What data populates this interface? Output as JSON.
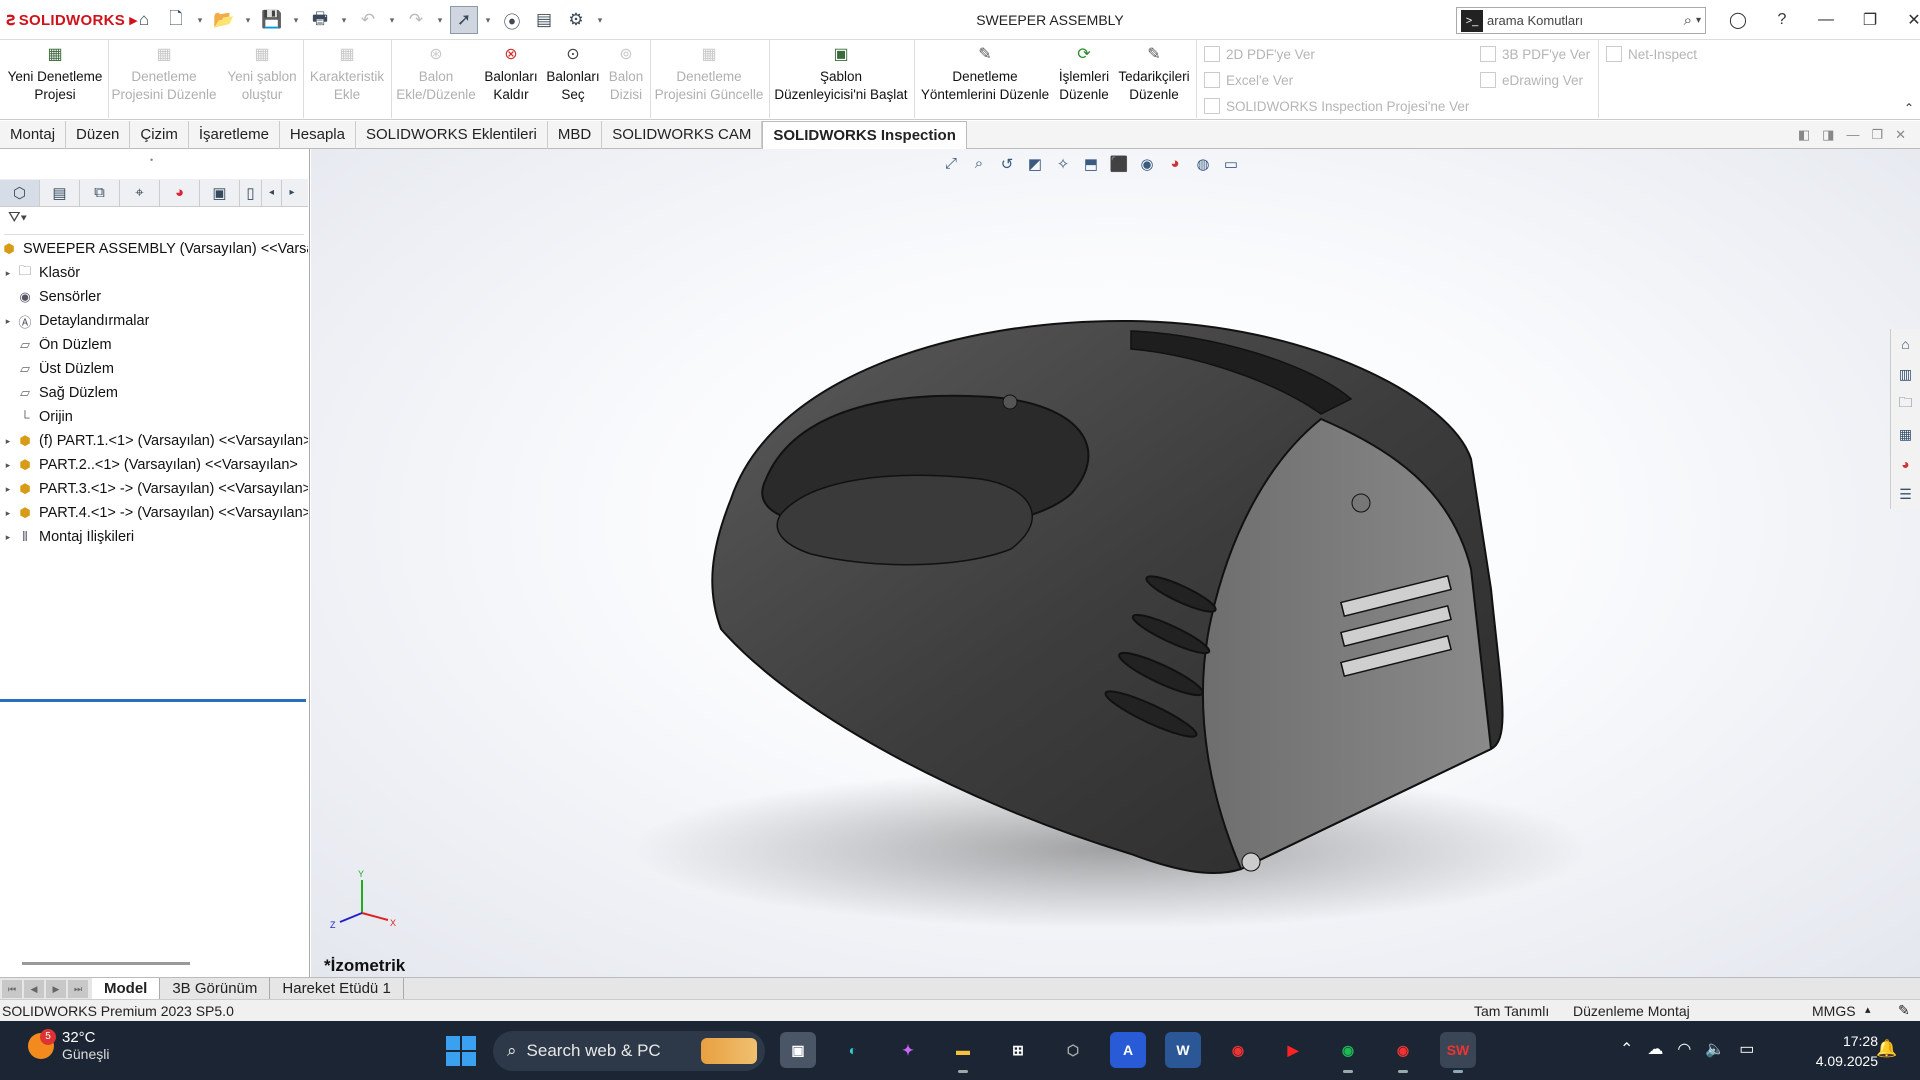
{
  "app": {
    "brand": "SOLIDWORKS",
    "window_title": "SWEEPER ASSEMBLY",
    "search_placeholder": "arama Komutları"
  },
  "ribbon": {
    "buttons": [
      {
        "label": "Yeni Denetleme\nProjesi",
        "enabled": true
      },
      {
        "label": "Denetleme\nProjesini Düzenle",
        "enabled": false
      },
      {
        "label": "Yeni şablon\noluştur",
        "enabled": false
      },
      {
        "label": "Karakteristik\nEkle",
        "enabled": false
      },
      {
        "label": "Balon\nEkle/Düzenle",
        "enabled": false
      },
      {
        "label": "Balonları\nKaldır",
        "enabled": true
      },
      {
        "label": "Balonları\nSeç",
        "enabled": true
      },
      {
        "label": "Balon\nDizisi",
        "enabled": false
      },
      {
        "label": "Denetleme\nProjesini Güncelle",
        "enabled": false
      },
      {
        "label": "Şablon\nDüzenleyicisi'ni Başlat",
        "enabled": true
      },
      {
        "label": "Denetleme\nYöntemlerini Düzenle",
        "enabled": true
      },
      {
        "label": "İşlemleri\nDüzenle",
        "enabled": true
      },
      {
        "label": "Tedarikçileri\nDüzenle",
        "enabled": true
      }
    ],
    "export_items": [
      "2D PDF'ye Ver",
      "Excel'e Ver",
      "SOLIDWORKS Inspection Projesi'ne Ver",
      "3B PDF'ye Ver",
      "eDrawing Ver",
      "Net-Inspect"
    ]
  },
  "tabs": [
    "Montaj",
    "Düzen",
    "Çizim",
    "İşaretleme",
    "Hesapla",
    "SOLIDWORKS Eklentileri",
    "MBD",
    "SOLIDWORKS CAM",
    "SOLIDWORKS Inspection"
  ],
  "active_tab": "SOLIDWORKS Inspection",
  "tree": {
    "root": "SWEEPER ASSEMBLY (Varsayılan) <<Varsayılan>",
    "items": [
      {
        "label": "Klasör",
        "expandable": true,
        "icon": "folder-icon"
      },
      {
        "label": "Sensörler",
        "expandable": false,
        "icon": "sensor-icon"
      },
      {
        "label": "Detaylandırmalar",
        "expandable": true,
        "icon": "annotation-icon"
      },
      {
        "label": "Ön Düzlem",
        "expandable": false,
        "icon": "plane-icon"
      },
      {
        "label": "Üst Düzlem",
        "expandable": false,
        "icon": "plane-icon"
      },
      {
        "label": "Sağ Düzlem",
        "expandable": false,
        "icon": "plane-icon"
      },
      {
        "label": "Orijin",
        "expandable": false,
        "icon": "origin-icon"
      },
      {
        "label": "(f) PART.1.<1> (Varsayılan) <<Varsayılan>",
        "expandable": true,
        "icon": "part-icon"
      },
      {
        "label": "PART.2..<1> (Varsayılan) <<Varsayılan>",
        "expandable": true,
        "icon": "part-icon"
      },
      {
        "label": "PART.3.<1> -> (Varsayılan) <<Varsayılan>",
        "expandable": true,
        "icon": "part-icon"
      },
      {
        "label": "PART.4.<1> -> (Varsayılan) <<Varsayılan>",
        "expandable": true,
        "icon": "part-icon"
      },
      {
        "label": "Montaj İlişkileri",
        "expandable": true,
        "icon": "mate-icon"
      }
    ]
  },
  "viewport": {
    "view_label": "*İzometrik",
    "triad": {
      "x": "X",
      "y": "Y",
      "z": "Z"
    }
  },
  "bottom_tabs": [
    "Model",
    "3B Görünüm",
    "Hareket Etüdü 1"
  ],
  "active_bottom_tab": "Model",
  "status": {
    "product": "SOLIDWORKS Premium 2023 SP5.0",
    "definition": "Tam Tanımlı",
    "mode": "Düzenleme Montaj",
    "units": "MMGS"
  },
  "taskbar": {
    "weather_temp": "32°C",
    "weather_desc": "Güneşli",
    "weather_badge": "5",
    "search_text": "Search web & PC",
    "time": "17:28",
    "date": "4.09.2025"
  },
  "colors": {
    "brand": "#d0121b",
    "accent": "#2a6fbf",
    "taskbar": "#1c2533"
  }
}
